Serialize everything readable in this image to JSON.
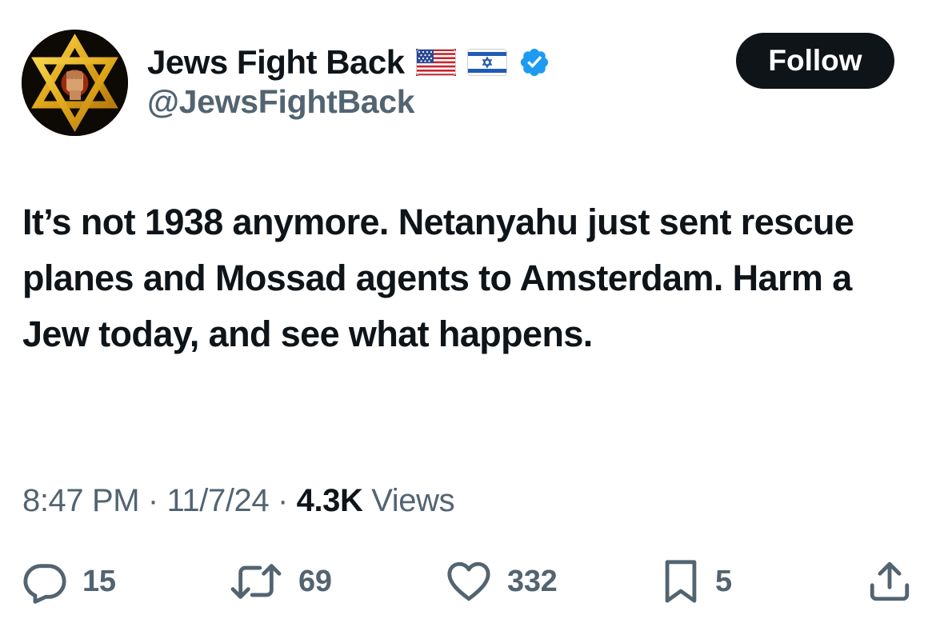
{
  "author": {
    "display_name": "Jews Fight Back",
    "handle": "@JewsFightBack",
    "flags": [
      "us-flag-icon",
      "israel-flag-icon"
    ],
    "verified_icon": "verified-badge-icon"
  },
  "follow_label": "Follow",
  "tweet_text": "It’s not 1938 anymore. Netanyahu just sent rescue planes and Mossad agents to Amsterdam. Harm a Jew today, and see what happens.",
  "meta": {
    "time": "8:47 PM",
    "separator": "·",
    "date": "11/7/24",
    "views_count": "4.3K",
    "views_label": "Views"
  },
  "actions": {
    "replies": "15",
    "reposts": "69",
    "likes": "332",
    "bookmarks": "5"
  },
  "colors": {
    "text": "#0f1419",
    "muted": "#536471",
    "verified": "#1d9bf0",
    "follow_bg": "#0f1419"
  }
}
